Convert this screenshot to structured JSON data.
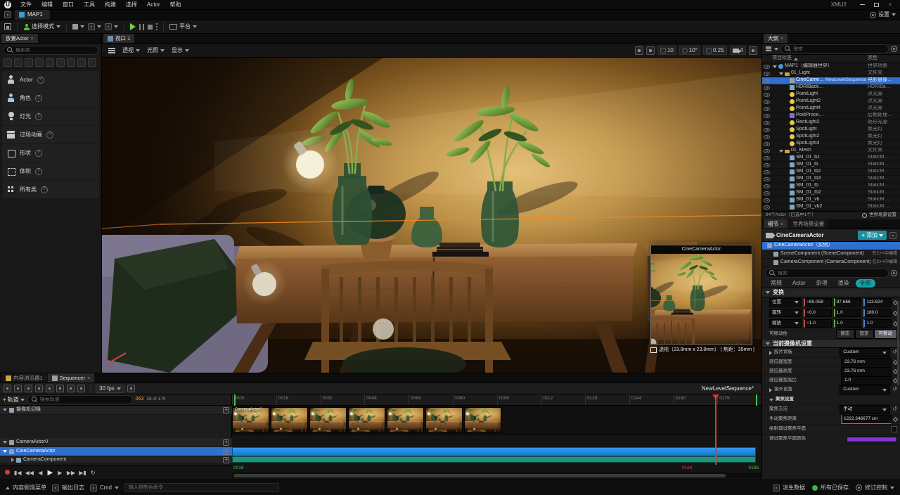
{
  "window": {
    "title": "XMU2"
  },
  "menu": {
    "items": [
      "文件",
      "编辑",
      "窗口",
      "工具",
      "构建",
      "选择",
      "Actor",
      "帮助"
    ]
  },
  "level_tab": {
    "label": "MAP1"
  },
  "settings": {
    "label": "设置"
  },
  "toolbar": {
    "mode": "选择模式",
    "platforms": "平台"
  },
  "place_panel": {
    "tab": "放置Actor",
    "search_placeholder": "搜索类",
    "recent": [
      {
        "name": "recent-item-1"
      },
      {
        "name": "recent-item-2"
      },
      {
        "name": "recent-item-3"
      },
      {
        "name": "recent-item-4"
      },
      {
        "name": "recent-item-5"
      },
      {
        "name": "recent-item-6"
      },
      {
        "name": "recent-item-7"
      },
      {
        "name": "recent-item-8"
      },
      {
        "name": "recent-item-9"
      }
    ],
    "categories": [
      {
        "icon": "person",
        "label": "Actor"
      },
      {
        "icon": "person2",
        "label": "角色"
      },
      {
        "icon": "bulb",
        "label": "灯光"
      },
      {
        "icon": "clapper",
        "label": "过场动画"
      },
      {
        "icon": "cube",
        "label": "形状"
      },
      {
        "icon": "volume",
        "label": "体积"
      },
      {
        "icon": "grid",
        "label": "所有类"
      }
    ]
  },
  "viewport": {
    "tab": "视口 1",
    "perspective": "透视",
    "lit": "光照",
    "show": "显示",
    "snap_move": "10",
    "snap_rotate": "10°",
    "snap_scale": "0.25",
    "camera_speed": "4",
    "preview": {
      "title": "CineCameraActor",
      "info": "透视（23.8mm x 23.8mm） | 焦距：35mm |"
    }
  },
  "outliner": {
    "tab": "大纲",
    "search_placeholder": "搜索",
    "col_label": "项目标签",
    "col_type": "类型",
    "rows": [
      {
        "indent": 0,
        "icon": "world",
        "caret": true,
        "label": "MAP1（编辑器世界）",
        "type": "世界场景"
      },
      {
        "indent": 1,
        "icon": "folder",
        "caret": true,
        "label": "01_Light",
        "type": "文件夹"
      },
      {
        "indent": 2,
        "icon": "cine",
        "label": "CineCame…",
        "badge": "NewLevelSequence",
        "type": "电影摄像…",
        "selected": true
      },
      {
        "indent": 2,
        "icon": "mesh",
        "label": "HDRIBack…",
        "type": "HDRIBa…"
      },
      {
        "indent": 2,
        "icon": "light",
        "label": "PointLight",
        "type": "点光源"
      },
      {
        "indent": 2,
        "icon": "light",
        "label": "PointLight2",
        "type": "点光源"
      },
      {
        "indent": 2,
        "icon": "light",
        "label": "PointLight4",
        "type": "点光源"
      },
      {
        "indent": 2,
        "icon": "post",
        "label": "PostProce…",
        "type": "后期处理…"
      },
      {
        "indent": 2,
        "icon": "light",
        "label": "RectLight2",
        "type": "矩形光源"
      },
      {
        "indent": 2,
        "icon": "light",
        "label": "SpotLight",
        "type": "聚光灯"
      },
      {
        "indent": 2,
        "icon": "light",
        "label": "SpotLight2",
        "type": "聚光灯"
      },
      {
        "indent": 2,
        "icon": "light",
        "label": "SpotLight4",
        "type": "聚光灯"
      },
      {
        "indent": 1,
        "icon": "folder",
        "caret": true,
        "label": "01_Mesh",
        "type": "文件夹"
      },
      {
        "indent": 2,
        "icon": "mesh",
        "label": "SM_01_b1",
        "type": "StaticM…"
      },
      {
        "indent": 2,
        "icon": "mesh",
        "label": "SM_01_lb",
        "type": "StaticM…"
      },
      {
        "indent": 2,
        "icon": "mesh",
        "label": "SM_01_lb2",
        "type": "StaticM…"
      },
      {
        "indent": 2,
        "icon": "mesh",
        "label": "SM_01_lb3",
        "type": "StaticM…"
      },
      {
        "indent": 2,
        "icon": "mesh",
        "label": "SM_01_tb",
        "type": "StaticM…"
      },
      {
        "indent": 2,
        "icon": "mesh",
        "label": "SM_01_tb2",
        "type": "StaticM…"
      },
      {
        "indent": 2,
        "icon": "mesh",
        "label": "SM_01_vb",
        "type": "StaticM…"
      },
      {
        "indent": 2,
        "icon": "mesh",
        "label": "SM_01_vb2",
        "type": "StaticM…"
      }
    ],
    "footer": "84个Actor（已选中1个）",
    "world_settings": "世界场景设置"
  },
  "details": {
    "tab": "细节",
    "world_tab": "世界场景设置",
    "actor_name": "CineCameraActor",
    "add_label": "添加",
    "components": [
      {
        "label": "CineCameraActor（实例）",
        "selected": true
      },
      {
        "label": "SceneComponent (SceneComponent)",
        "note": "在C++中编辑",
        "indent": 1
      },
      {
        "label": "CameraComponent (CameraComponent)",
        "note": "在C++中编辑",
        "indent": 1
      }
    ],
    "search_placeholder": "搜索",
    "filters": [
      {
        "label": "常规"
      },
      {
        "label": "Actor"
      },
      {
        "label": "杂项"
      },
      {
        "label": "渲染"
      },
      {
        "label": "全部",
        "active": true
      }
    ],
    "transform": {
      "section": "变换",
      "location_label": "位置",
      "location": [
        "69.058",
        "97.666",
        "113.624"
      ],
      "rotation_label": "旋转",
      "rotation": [
        "0.0",
        "1.0",
        "180.0"
      ],
      "scale_label": "缩放",
      "scale": [
        "1.0",
        "1.0",
        "1.0"
      ],
      "mobility_label": "可移动性",
      "mobility_options": [
        "静态",
        "固定",
        "可移动"
      ]
    },
    "camera_section": "当前摄像机设置",
    "filmback_label": "胶片背板",
    "filmback_value": "Custom",
    "sensor_width_label": "感应器宽度",
    "sensor_width": "23.76 mm",
    "sensor_height_label": "感应器高度",
    "sensor_height": "23.76 mm",
    "sensor_ratio_label": "感应器宽高比",
    "sensor_ratio": "1.0",
    "lens_label": "镜头设置",
    "lens_value": "Custom",
    "focus_section": "聚焦设置",
    "focus_method_label": "聚焦方法",
    "focus_method": "手动",
    "focus_distance_label": "手动聚焦距离",
    "focus_distance": "1222.346677 cm",
    "draw_debug_label": "绘制调试聚焦平面",
    "debug_color_label": "调试聚焦平面颜色",
    "debug_color": "#8633d8"
  },
  "sequencer": {
    "browser_tab": "内容浏览器1",
    "tab": "Sequencer",
    "toolbar_icons": [
      {
        "name": "sequencer-save-icon"
      },
      {
        "name": "find-asset-icon"
      },
      {
        "name": "create-camera-icon"
      },
      {
        "name": "render-movie-icon"
      },
      {
        "name": "actions-icon"
      },
      {
        "name": "keyframe-options-icon"
      },
      {
        "name": "autokey-icon"
      },
      {
        "name": "snap-icon"
      }
    ],
    "fps": "30 fps",
    "sequence_name": "NewLevelSequence*",
    "add_track": "轨道",
    "search_placeholder": "搜索轨道",
    "frame_current": "063",
    "frame_label": "28 of 179",
    "cut_label": "CameraActor0",
    "tracks": [
      {
        "name": "摄像机切换"
      },
      {
        "name": "CameraActor0"
      },
      {
        "name": "CineCameraActor"
      },
      {
        "name": "CameraComponent"
      }
    ],
    "ruler": [
      "0000",
      "0016",
      "0032",
      "0048",
      "0064",
      "0080",
      "0096",
      "0112",
      "0128",
      "0144",
      "0160",
      "0176"
    ],
    "thumbs": [
      1,
      2,
      3,
      4,
      5,
      6,
      7
    ],
    "range_start": "0016",
    "playhead_frame": "0164",
    "range_end": "0186"
  },
  "statusbar": {
    "content_drawer": "内容侧滑菜单",
    "output_log": "输出日志",
    "cmd": "Cmd",
    "console_placeholder": "输入控制台命令",
    "derived_data": "派生数据",
    "saved": "所有已保存",
    "revision": "修订控制"
  }
}
